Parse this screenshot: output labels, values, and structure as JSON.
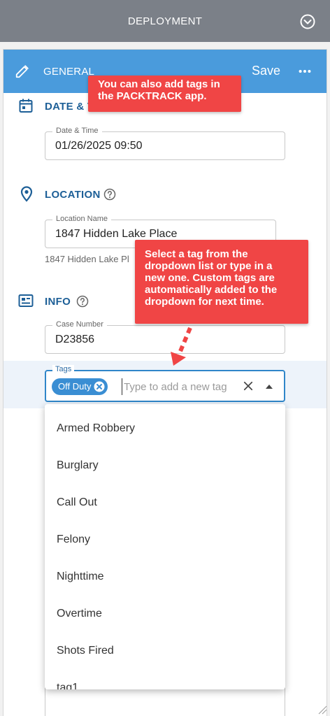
{
  "topbar": {
    "title": "DEPLOYMENT",
    "icon": "chevron-circle-icon"
  },
  "header": {
    "title": "GENERAL",
    "save_label": "Save",
    "more_icon": "more-horizontal-icon"
  },
  "sections": {
    "datetime": {
      "title": "DATE & T",
      "icon": "calendar-icon",
      "field_label": "Date & Time",
      "field_value": "01/26/2025 09:50"
    },
    "location": {
      "title": "LOCATION",
      "icon": "map-pin-icon",
      "help_icon": "help-circle-icon",
      "field_label": "Location Name",
      "field_value": "1847 Hidden Lake Place",
      "helper_text": "1847 Hidden Lake Pl"
    },
    "info": {
      "title": "INFO",
      "icon": "id-card-icon",
      "help_icon": "help-circle-icon",
      "case_label": "Case Number",
      "case_value": "D23856"
    }
  },
  "tags": {
    "label": "Tags",
    "chips": [
      {
        "label": "Off Duty"
      }
    ],
    "placeholder": "Type to add a new tag",
    "options": [
      "Armed Robbery",
      "Burglary",
      "Call Out",
      "Felony",
      "Nighttime",
      "Overtime",
      "Shots Fired",
      "tag1"
    ]
  },
  "callouts": {
    "top": {
      "lines": [
        "You can also add tags in",
        "the PACKTRACK app."
      ]
    },
    "dropdown": {
      "lines": [
        "Select a tag from the",
        "dropdown list or type in a",
        "new one. Custom tags are",
        "automatically added to the",
        "dropdown for next time."
      ]
    }
  },
  "colors": {
    "topbar": "#7b8088",
    "header": "#4a9bdc",
    "accent": "#1d5f97",
    "chip": "#3a8ed3",
    "callout": "#f04545"
  }
}
